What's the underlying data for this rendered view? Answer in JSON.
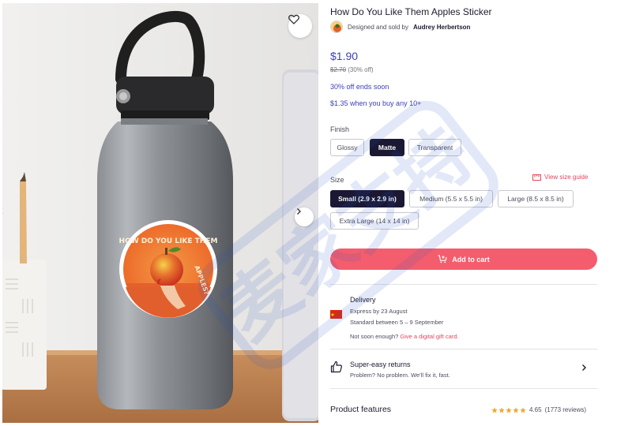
{
  "product": {
    "title": "How Do You Like Them Apples Sticker",
    "designer_prefix": "Designed and sold by",
    "designer_name": "Audrey Herbertson"
  },
  "pricing": {
    "price": "$1.90",
    "old_price": "$2.70",
    "discount": "(30% off)",
    "sale_note": "30% off ends soon",
    "bulk_note": "$1.35 when you buy any 10+"
  },
  "finish": {
    "label": "Finish",
    "options": [
      {
        "label": "Glossy",
        "selected": false
      },
      {
        "label": "Matte",
        "selected": true
      },
      {
        "label": "Transparent",
        "selected": false
      }
    ]
  },
  "size": {
    "label": "Size",
    "guide_link": "View size guide",
    "options": [
      {
        "label": "Small (2.9 x 2.9 in)",
        "selected": true
      },
      {
        "label": "Medium (5.5 x 5.5 in)",
        "selected": false
      },
      {
        "label": "Large (8.5 x 8.5 in)",
        "selected": false
      },
      {
        "label": "Extra Large (14 x 14 in)",
        "selected": false
      }
    ]
  },
  "cart": {
    "add_label": "Add to cart"
  },
  "delivery": {
    "title": "Delivery",
    "express": "Express by 23 August",
    "standard": "Standard between 5 – 9 September",
    "note_prefix": "Not soon enough?",
    "gift_link": "Give a digital gift card."
  },
  "returns": {
    "title": "Super-easy returns",
    "subtitle": "Problem? No problem. We'll fix it, fast."
  },
  "features": {
    "title": "Product features",
    "rating_value": "4.65",
    "rating_count": "(1773 reviews)",
    "stars": 5
  },
  "sticker": {
    "text": "How Do You Like Them Apples?"
  },
  "watermark": {
    "text": "麦家支持"
  },
  "colors": {
    "accent": "#3b3fb6",
    "cta": "#f45d6e",
    "selected_option": "#1a1833",
    "link_red": "#e5465f",
    "star": "#f0a92e"
  }
}
